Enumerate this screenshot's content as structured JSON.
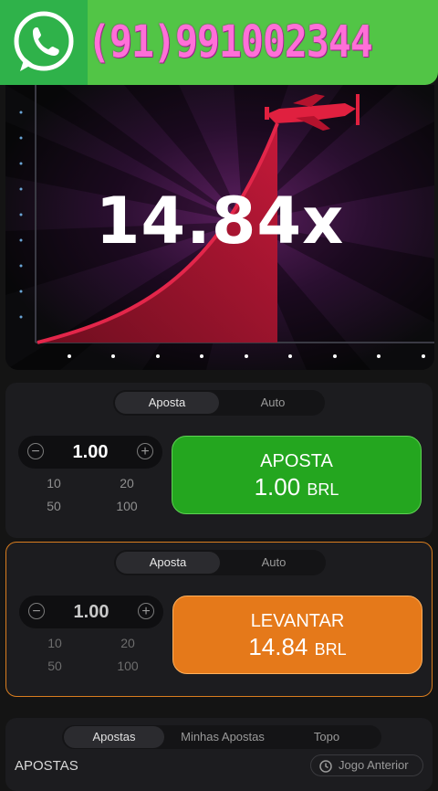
{
  "banner": {
    "phone": "(91)991002344",
    "logo": "whatsapp-icon"
  },
  "game": {
    "multiplier": "14.84x"
  },
  "panel1": {
    "tabs": [
      "Aposta",
      "Auto"
    ],
    "amount": "1.00",
    "quick": [
      "10",
      "20",
      "50",
      "100"
    ],
    "button_label": "APOSTA",
    "button_amount": "1.00",
    "currency": "BRL"
  },
  "panel2": {
    "tabs": [
      "Aposta",
      "Auto"
    ],
    "amount": "1.00",
    "quick": [
      "10",
      "20",
      "50",
      "100"
    ],
    "button_label": "LEVANTAR",
    "button_amount": "14.84",
    "currency": "BRL"
  },
  "bets": {
    "tabs": [
      "Apostas",
      "Minhas Apostas",
      "Topo"
    ],
    "title": "APOSTAS",
    "previous": "Jogo Anterior"
  },
  "colors": {
    "bet_button": "#24a61f",
    "cashout_button": "#e5791a",
    "curve": "#d1223d",
    "phone": "#ff6fd8"
  }
}
